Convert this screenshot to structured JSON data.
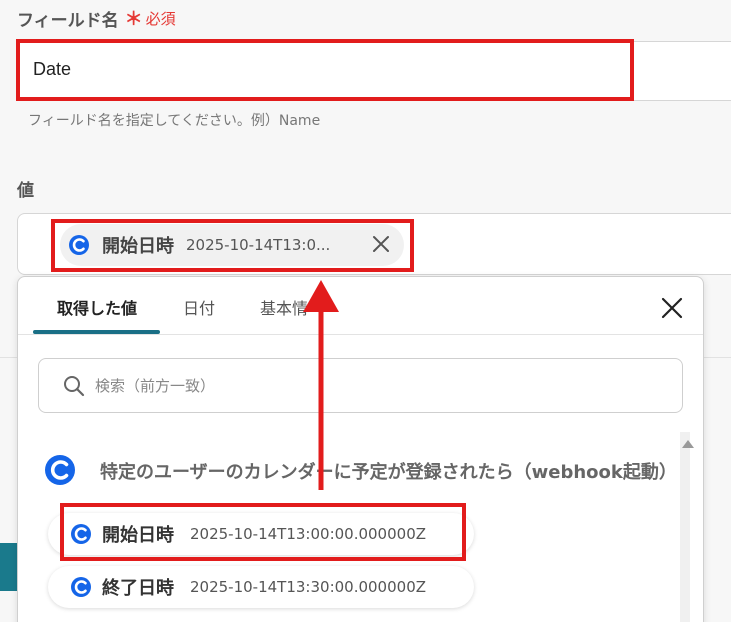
{
  "field": {
    "label": "フィールド名",
    "required_star": "＊",
    "required_text": "必須",
    "value": "Date",
    "hint": "フィールド名を指定してください。例）Name"
  },
  "value_field": {
    "label": "値",
    "chip_label": "開始日時",
    "chip_value": "2025-10-14T13:0..."
  },
  "dropdown": {
    "tabs": [
      "取得した値",
      "日付",
      "基本情"
    ],
    "active_tab": 0,
    "search_placeholder": "検索（前方一致）",
    "group_title": "特定のユーザーのカレンダーに予定が登録されたら（webhook起動）",
    "items": [
      {
        "label": "開始日時",
        "value": "2025-10-14T13:00:00.000000Z"
      },
      {
        "label": "終了日時",
        "value": "2025-10-14T13:30:00.000000Z"
      }
    ]
  },
  "colors": {
    "highlight": "#e21c1c",
    "brand_blue": "#1565e8",
    "tab_accent": "#1a6f86",
    "required": "#e53935"
  },
  "icons": [
    "app-logo-icon",
    "close-icon",
    "search-icon",
    "scroll-up-icon"
  ]
}
